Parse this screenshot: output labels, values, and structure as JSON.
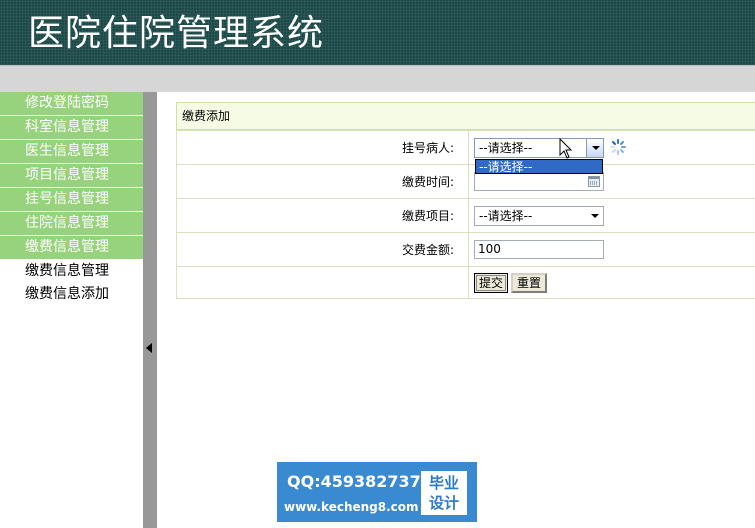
{
  "header": {
    "title": "医院住院管理系统"
  },
  "sidebar": {
    "items": [
      {
        "label": "修改登陆密码"
      },
      {
        "label": "科室信息管理"
      },
      {
        "label": "医生信息管理"
      },
      {
        "label": "项目信息管理"
      },
      {
        "label": "挂号信息管理"
      },
      {
        "label": "住院信息管理"
      },
      {
        "label": "缴费信息管理"
      }
    ],
    "subitems": [
      {
        "label": "缴费信息管理"
      },
      {
        "label": "缴费信息添加"
      }
    ]
  },
  "form": {
    "title": "缴费添加",
    "patient": {
      "label": "挂号病人:",
      "selected": "--请选择--",
      "dropdown_option": "--请选择--"
    },
    "time": {
      "label": "缴费时间:",
      "value": ""
    },
    "item": {
      "label": "缴费项目:",
      "selected": "--请选择--"
    },
    "amount": {
      "label": "交费金额:",
      "value": "100"
    },
    "submit_label": "提交",
    "reset_label": "重置"
  },
  "watermark": {
    "qq": "QQ:459382737",
    "site": "www.kecheng8.com",
    "badge_line1": "毕业",
    "badge_line2": "设计"
  },
  "icons": {
    "cursor": "mouse-pointer-icon",
    "spinner": "loading-spinner-icon",
    "calendar": "calendar-icon",
    "collapse": "collapse-arrow-icon"
  },
  "colors": {
    "header_bg": "#1c4a48",
    "menu_bg": "#97d27d",
    "selection": "#316ac5",
    "watermark_bg": "#3a8ad2"
  }
}
